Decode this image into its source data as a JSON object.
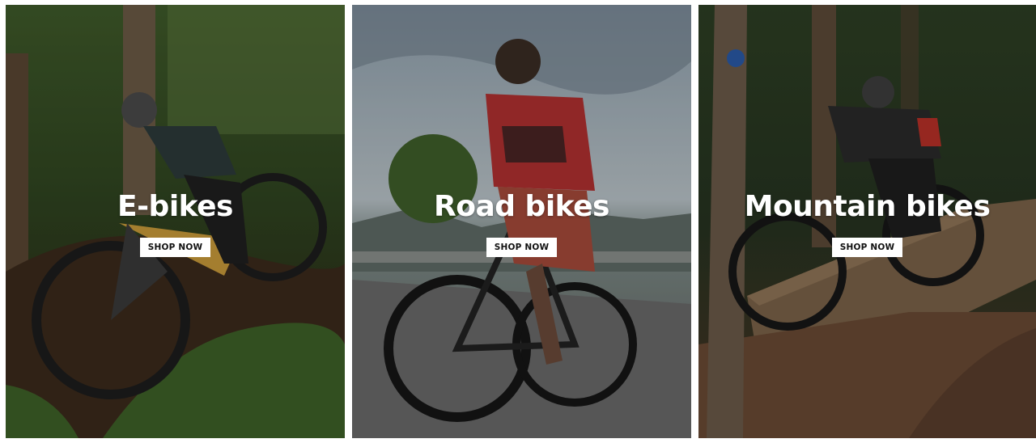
{
  "categories": [
    {
      "title": "E-bikes",
      "button_label": "SHOP NOW",
      "image": "mountain-rider-on-yellow-e-bike-in-forest"
    },
    {
      "title": "Road bikes",
      "button_label": "SHOP NOW",
      "image": "road-cyclist-in-red-jersey-on-mountain-road"
    },
    {
      "title": "Mountain bikes",
      "button_label": "SHOP NOW",
      "image": "mountain-biker-on-wooden-ramp-in-forest"
    }
  ],
  "colors": {
    "title_text": "#ffffff",
    "button_bg": "#ffffff",
    "button_text": "#111111"
  }
}
